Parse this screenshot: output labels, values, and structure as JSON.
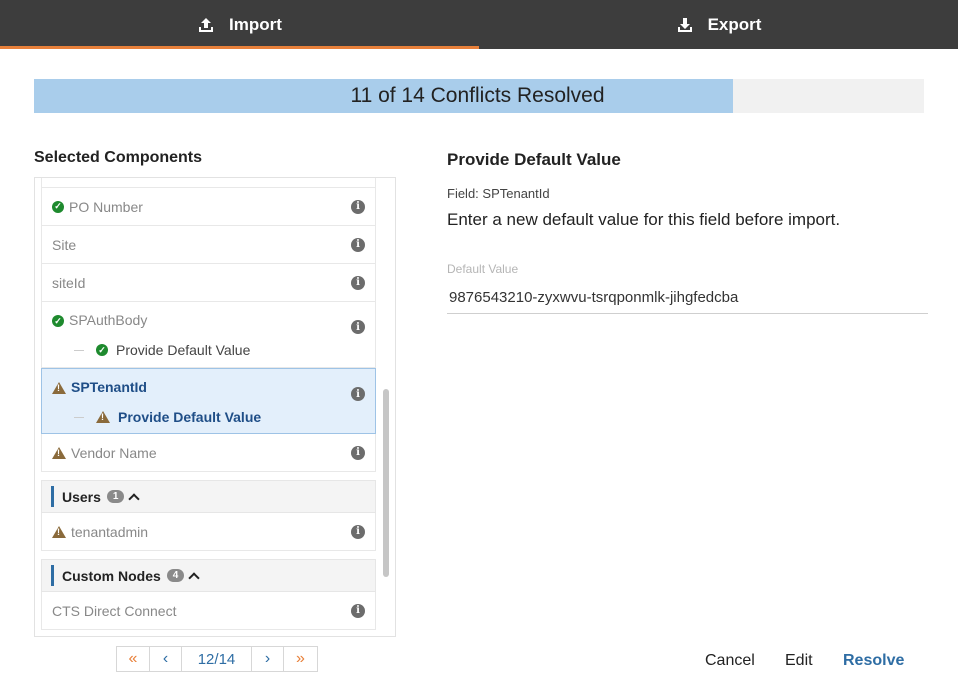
{
  "tabs": [
    {
      "label": "Import",
      "icon": "upload-icon",
      "active": true
    },
    {
      "label": "Export",
      "icon": "download-icon",
      "active": false
    }
  ],
  "progress": {
    "text": "11 of 14 Conflicts Resolved",
    "resolved": 11,
    "total": 14
  },
  "left": {
    "title": "Selected Components",
    "rows": [
      {
        "label": "PO Number",
        "status": "ok"
      },
      {
        "label": "Site",
        "status": "none"
      },
      {
        "label": "siteId",
        "status": "none"
      },
      {
        "label": "SPAuthBody",
        "status": "ok",
        "sub": "Provide Default Value",
        "sub_status": "ok"
      },
      {
        "label": "SPTenantId",
        "status": "warn",
        "sub": "Provide Default Value",
        "sub_status": "warn",
        "selected": true
      },
      {
        "label": "Vendor Name",
        "status": "warn"
      }
    ],
    "groups": [
      {
        "label": "Users",
        "count": "1",
        "rows": [
          {
            "label": "tenantadmin",
            "status": "warn"
          }
        ]
      },
      {
        "label": "Custom Nodes",
        "count": "4",
        "rows": [
          {
            "label": "CTS Direct Connect",
            "status": "none"
          }
        ]
      }
    ]
  },
  "pager": {
    "first": "«",
    "prev": "‹",
    "page": "12/14",
    "next": "›",
    "last": "»"
  },
  "right": {
    "title": "Provide Default Value",
    "field": "Field: SPTenantId",
    "description": "Enter a new default value for this field before import.",
    "input_label": "Default Value",
    "input_value": "9876543210-zyxwvu-tsrqponmlk-jihgfedcba"
  },
  "actions": {
    "cancel": "Cancel",
    "edit": "Edit",
    "resolve": "Resolve"
  },
  "colors": {
    "accent": "#e8803a",
    "link": "#2e6da4",
    "progress_fill": "#a9cdeb",
    "ok": "#1e8a2e",
    "warn": "#8a6a3b"
  }
}
